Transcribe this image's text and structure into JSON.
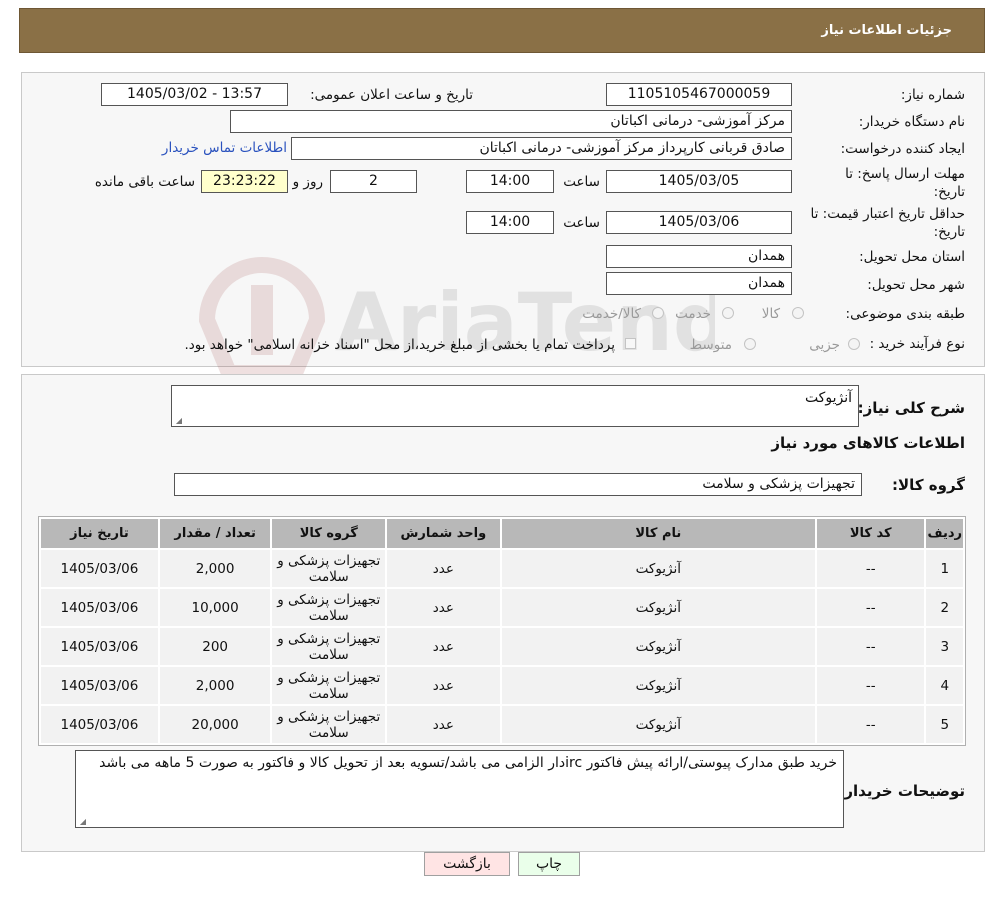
{
  "header": {
    "title": "جزئیات اطلاعات نیاز"
  },
  "fields": {
    "need_number_label": "شماره نیاز:",
    "need_number": "1105105467000059",
    "announce_label": "تاریخ و ساعت اعلان عمومی:",
    "announce_value": "1405/03/02 - 13:57",
    "buyer_org_label": "نام دستگاه خریدار:",
    "buyer_org": "مرکز آموزشی- درمانی اکباتان",
    "requester_label": "ایجاد کننده درخواست:",
    "requester": "صادق قربانی کارپرداز مرکز آموزشی- درمانی اکباتان",
    "contact_link": "اطلاعات تماس خریدار",
    "deadline_label_1": "مهلت ارسال پاسخ: تا",
    "deadline_label_2": "تاریخ:",
    "deadline_date": "1405/03/05",
    "time_label": "ساعت",
    "deadline_time": "14:00",
    "days_value": "2",
    "days_label": "روز و",
    "remaining_time": "23:23:22",
    "remaining_label": "ساعت باقی مانده",
    "validity_label_1": "حداقل تاریخ اعتبار قیمت: تا",
    "validity_label_2": "تاریخ:",
    "validity_date": "1405/03/06",
    "validity_time": "14:00",
    "province_label": "استان محل تحویل:",
    "province": "همدان",
    "city_label": "شهر محل تحویل:",
    "city": "همدان",
    "category_label": "طبقه بندی موضوعی:",
    "category_options": [
      "کالا",
      "خدمت",
      "کالا/خدمت"
    ],
    "process_label": "نوع فرآیند خرید :",
    "process_options": [
      "جزیی",
      "متوسط"
    ],
    "payment_note": "پرداخت تمام یا بخشی از مبلغ خرید،از محل \"اسناد خزانه اسلامی\" خواهد بود."
  },
  "description": {
    "label": "شرح کلی نیاز:",
    "value": "آنژیوکت",
    "items_heading": "اطلاعات کالاهای مورد نیاز",
    "group_label": "گروه کالا:",
    "group_value": "تجهیزات پزشکی و سلامت"
  },
  "table": {
    "headers": [
      "ردیف",
      "کد کالا",
      "نام کالا",
      "واحد شمارش",
      "گروه کالا",
      "تعداد / مقدار",
      "تاریخ نیاز"
    ],
    "rows": [
      [
        "1",
        "--",
        "آنژیوکت",
        "عدد",
        "تجهیزات پزشکی و سلامت",
        "2,000",
        "1405/03/06"
      ],
      [
        "2",
        "--",
        "آنژیوکت",
        "عدد",
        "تجهیزات پزشکی و سلامت",
        "10,000",
        "1405/03/06"
      ],
      [
        "3",
        "--",
        "آنژیوکت",
        "عدد",
        "تجهیزات پزشکی و سلامت",
        "200",
        "1405/03/06"
      ],
      [
        "4",
        "--",
        "آنژیوکت",
        "عدد",
        "تجهیزات پزشکی و سلامت",
        "2,000",
        "1405/03/06"
      ],
      [
        "5",
        "--",
        "آنژیوکت",
        "عدد",
        "تجهیزات پزشکی و سلامت",
        "20,000",
        "1405/03/06"
      ]
    ]
  },
  "buyer_notes": {
    "label": "توضیحات خریدار:",
    "value": "خرید طبق مدارک پیوستی/ارائه پیش فاکتور ircدار الزامی می باشد/تسویه بعد از تحویل کالا و فاکتور به صورت 5 ماهه می باشد"
  },
  "buttons": {
    "print": "چاپ",
    "back": "بازگشت"
  },
  "watermark": {
    "text": "AriaTender.neT"
  },
  "colors": {
    "header_bg": "#8a7046",
    "link": "#2a52be",
    "print_bg": "#eaffea",
    "back_bg": "#ffe4e4"
  }
}
